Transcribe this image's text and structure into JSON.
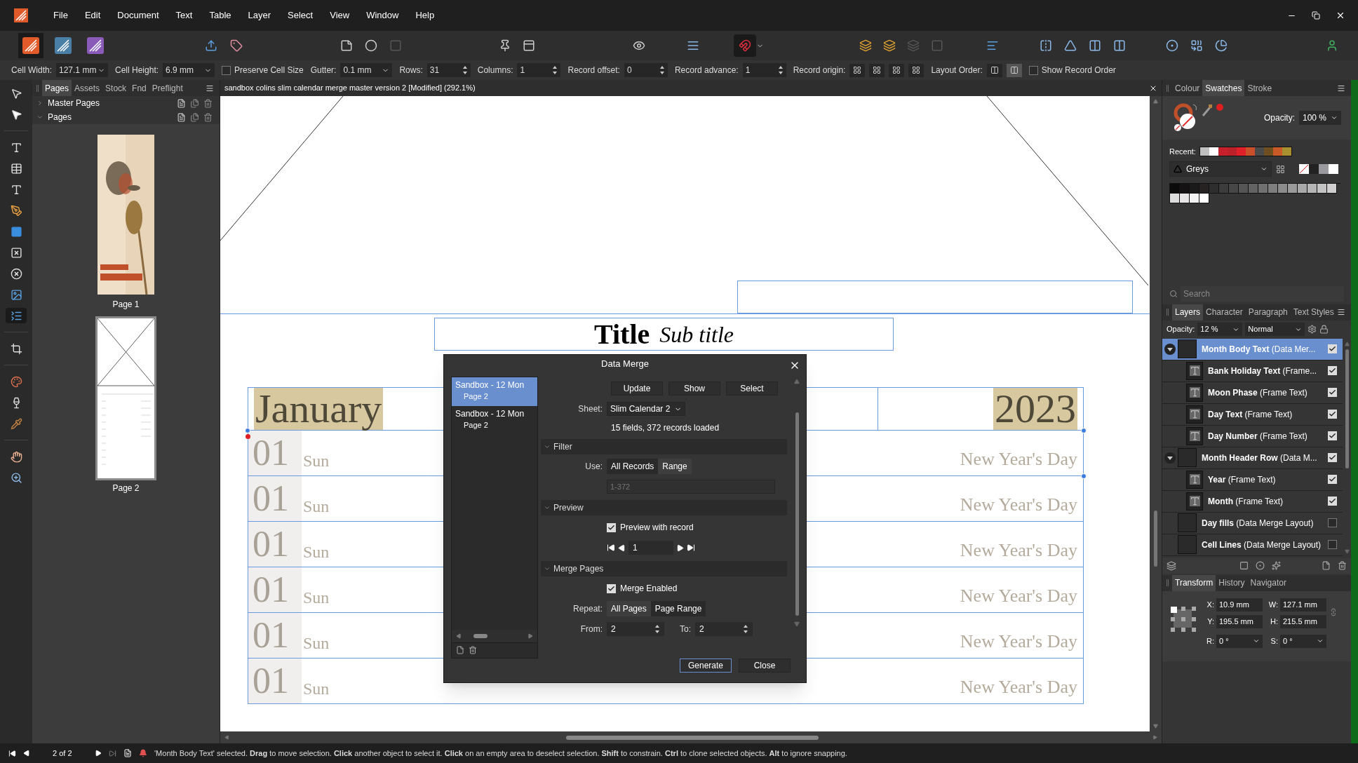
{
  "menu": [
    "File",
    "Edit",
    "Document",
    "Text",
    "Table",
    "Layer",
    "Select",
    "View",
    "Window",
    "Help"
  ],
  "context_bar": [
    {
      "kind": "dropdown",
      "label": "Cell Width:",
      "value": "127.1 mm"
    },
    {
      "kind": "dropdown",
      "label": "Cell Height:",
      "value": "6.9 mm"
    },
    {
      "kind": "checkbox",
      "label": "Preserve Cell Size",
      "checked": false
    },
    {
      "kind": "dropdown",
      "label": "Gutter:",
      "value": "0.1 mm"
    },
    {
      "kind": "spinner",
      "label": "Rows:",
      "value": "31"
    },
    {
      "kind": "spinner",
      "label": "Columns:",
      "value": "1"
    },
    {
      "kind": "spinner",
      "label": "Record offset:",
      "value": "0"
    },
    {
      "kind": "spinner",
      "label": "Record advance:",
      "value": "1"
    },
    {
      "kind": "origin",
      "label": "Record origin:"
    },
    {
      "kind": "order",
      "label": "Layout Order:"
    },
    {
      "kind": "checkbox",
      "label": "Show Record Order",
      "checked": false
    }
  ],
  "left_panel": {
    "tabs": [
      {
        "label": "Pages",
        "selected": true
      },
      {
        "label": "Assets",
        "selected": false
      },
      {
        "label": "Stock",
        "selected": false
      },
      {
        "label": "Fnd",
        "selected": false
      },
      {
        "label": "Preflight",
        "selected": false
      }
    ],
    "sections": [
      {
        "label": "Master Pages",
        "expanded": false
      },
      {
        "label": "Pages",
        "expanded": true
      }
    ],
    "pages": [
      {
        "label": "Page 1",
        "kind": "picture",
        "selected": false
      },
      {
        "label": "Page 2",
        "kind": "layout",
        "selected": true
      }
    ]
  },
  "document_tab": {
    "title": "sandbox colins slim calendar merge master version 2 [Modified] (292.1%)"
  },
  "canvas": {
    "title": "Title",
    "subtitle": "Sub title",
    "month": "January",
    "year": "2023",
    "rows": [
      {
        "day": "01",
        "weekday": "Sun",
        "holiday": "New Year's Day"
      },
      {
        "day": "01",
        "weekday": "Sun",
        "holiday": "New Year's Day"
      },
      {
        "day": "01",
        "weekday": "Sun",
        "holiday": "New Year's Day"
      },
      {
        "day": "01",
        "weekday": "Sun",
        "holiday": "New Year's Day"
      },
      {
        "day": "01",
        "weekday": "Sun",
        "holiday": "New Year's Day"
      },
      {
        "day": "01",
        "weekday": "Sun",
        "holiday": "New Year's Day"
      }
    ]
  },
  "dialog": {
    "title": "Data Merge",
    "records": [
      {
        "name": "Sandbox - 12 Mon",
        "page": "Page 2",
        "selected": true
      },
      {
        "name": "Sandbox - 12 Mon",
        "page": "Page 2",
        "selected": false
      }
    ],
    "buttons": [
      "Update",
      "Show",
      "Select"
    ],
    "sheet_label": "Sheet:",
    "sheet": "Slim Calendar 2",
    "status": "15 fields, 372 records loaded",
    "filter": {
      "heading": "Filter",
      "expanded": true,
      "use_label": "Use:",
      "options": [
        {
          "label": "All Records",
          "selected": true
        },
        {
          "label": "Range",
          "selected": false
        }
      ],
      "range_placeholder": "1-372"
    },
    "preview": {
      "heading": "Preview",
      "expanded": true,
      "checkbox": {
        "label": "Preview with record",
        "checked": true
      },
      "record": "1"
    },
    "merge_pages": {
      "heading": "Merge Pages",
      "expanded": true,
      "checkbox": {
        "label": "Merge Enabled",
        "checked": true
      },
      "repeat_label": "Repeat:",
      "options": [
        {
          "label": "All Pages",
          "selected": false
        },
        {
          "label": "Page Range",
          "selected": true
        }
      ],
      "from_label": "From:",
      "from": "2",
      "to_label": "To:",
      "to": "2"
    },
    "footer_buttons": [
      {
        "label": "Generate",
        "default": true
      },
      {
        "label": "Close",
        "default": false
      }
    ]
  },
  "swatches_panel": {
    "tabs": [
      {
        "label": "Colour",
        "selected": false
      },
      {
        "label": "Swatches",
        "selected": true
      },
      {
        "label": "Stroke",
        "selected": false
      }
    ],
    "opacity_label": "Opacity:",
    "opacity": "100 %",
    "recent_label": "Recent:",
    "recent": [
      {
        "color": "#c0c0c0"
      },
      {
        "color": "#ffffff"
      },
      {
        "color": "#c8202a"
      },
      {
        "color": "#bc2028"
      },
      {
        "color": "#e02028"
      },
      {
        "color": "#c8502a"
      },
      {
        "color": "#4a4a4a"
      },
      {
        "color": "#6e5020"
      },
      {
        "color": "#c85a28"
      },
      {
        "color": "#a89030"
      }
    ],
    "palette": "Greys",
    "swatches": [
      {
        "color": "#0a0a0a"
      },
      {
        "color": "#141212"
      },
      {
        "color": "#1a1a1a"
      },
      {
        "color": "#262222"
      },
      {
        "color": "#2e2e2e"
      },
      {
        "color": "#3c3c3c"
      },
      {
        "color": "#474747"
      },
      {
        "color": "#555555"
      },
      {
        "color": "#636363"
      },
      {
        "color": "#707070"
      },
      {
        "color": "#7e7e7e"
      },
      {
        "color": "#8c8c8c"
      },
      {
        "color": "#9a9a9a"
      },
      {
        "color": "#a8a8a8"
      },
      {
        "color": "#b5b5b5"
      },
      {
        "color": "#c3c3c3"
      },
      {
        "color": "#d0cece"
      },
      {
        "color": "#dcdcdc"
      },
      {
        "color": "#e8e6e6"
      },
      {
        "color": "#f3f3f3"
      },
      {
        "color": "#ffffff"
      }
    ],
    "search_placeholder": "Search"
  },
  "layers_panel": {
    "tabs": [
      {
        "label": "Layers",
        "selected": true
      },
      {
        "label": "Character",
        "selected": false
      },
      {
        "label": "Paragraph",
        "selected": false
      },
      {
        "label": "Text Styles",
        "selected": false
      }
    ],
    "opacity_label": "Opacity:",
    "opacity": "12 %",
    "blend": "Normal",
    "layers": [
      {
        "name": "**Month Body Text** (Data Mer...",
        "kind": "group",
        "selected": true,
        "expanded": true,
        "visible": true,
        "children": [
          {
            "name": "**Bank Holiday Text** (Frame...",
            "kind": "text",
            "selected": false,
            "visible": true
          },
          {
            "name": "**Moon Phase** (Frame Text)",
            "kind": "text",
            "selected": false,
            "visible": true
          },
          {
            "name": "**Day Text** (Frame Text)",
            "kind": "text",
            "selected": false,
            "visible": true
          },
          {
            "name": "**Day Number** (Frame Text)",
            "kind": "text",
            "selected": false,
            "visible": true
          }
        ]
      },
      {
        "name": "**Month Header Row** (Data M...",
        "kind": "group",
        "selected": false,
        "expanded": true,
        "visible": true,
        "children": [
          {
            "name": "**Year** (Frame Text)",
            "kind": "text",
            "selected": false,
            "visible": true
          },
          {
            "name": "**Month** (Frame Text)",
            "kind": "text",
            "selected": false,
            "visible": true
          }
        ]
      },
      {
        "name": "**Day fills** (Data Merge Layout)",
        "kind": "group",
        "selected": false,
        "visible": false
      },
      {
        "name": "**Cell Lines** (Data Merge Layout)",
        "kind": "group",
        "selected": false,
        "visible": false
      }
    ]
  },
  "transform_panel": {
    "tabs": [
      {
        "label": "Transform",
        "selected": true
      },
      {
        "label": "History",
        "selected": false
      },
      {
        "label": "Navigator",
        "selected": false
      }
    ],
    "fields": [
      {
        "label": "X:",
        "value": "10.9 mm",
        "kind": "text"
      },
      {
        "label": "W:",
        "value": "127.1 mm",
        "kind": "text"
      },
      {
        "label": "Y:",
        "value": "195.5 mm",
        "kind": "text"
      },
      {
        "label": "H:",
        "value": "215.5 mm",
        "kind": "text"
      },
      {
        "label": "R:",
        "value": "0 °",
        "kind": "dropdown"
      },
      {
        "label": "S:",
        "value": "0 °",
        "kind": "dropdown"
      }
    ]
  },
  "status_bar": {
    "page": "2 of 2",
    "message": "'Month Body Text' selected. **Drag** to move selection. **Click** another object to select it. **Click** on an empty area to deselect selection. **Shift** to constrain. **Ctrl** to clone selected objects. **Alt** to ignore snapping."
  }
}
